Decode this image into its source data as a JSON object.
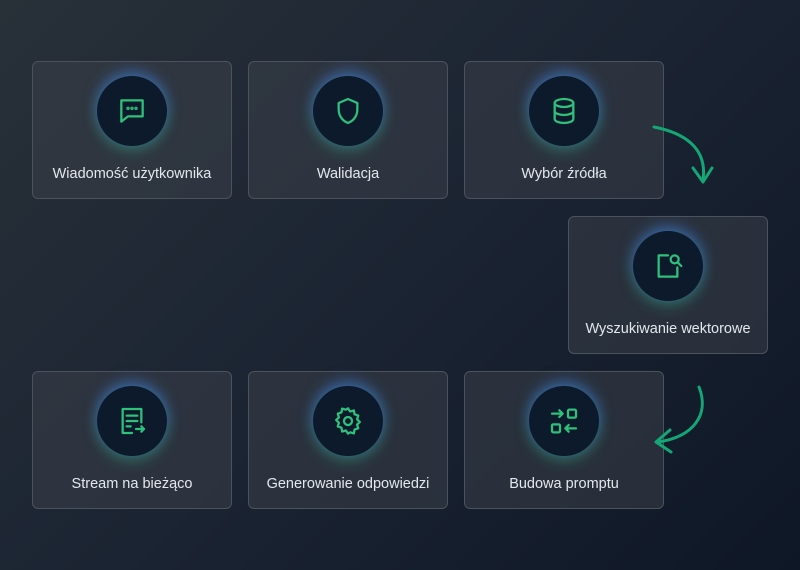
{
  "accent_color": "#2fc07a",
  "steps": [
    {
      "label": "Wiadomość użytkownika",
      "icon": "chat-bubble-icon"
    },
    {
      "label": "Walidacja",
      "icon": "shield-icon"
    },
    {
      "label": "Wybór źródła",
      "icon": "database-icon"
    },
    {
      "label": "Wyszukiwanie wektorowe",
      "icon": "search-document-icon"
    },
    {
      "label": "Budowa promptu",
      "icon": "transform-icon"
    },
    {
      "label": "Generowanie odpowiedzi",
      "icon": "gear-icon"
    },
    {
      "label": "Stream na bieżąco",
      "icon": "stream-document-icon"
    }
  ]
}
